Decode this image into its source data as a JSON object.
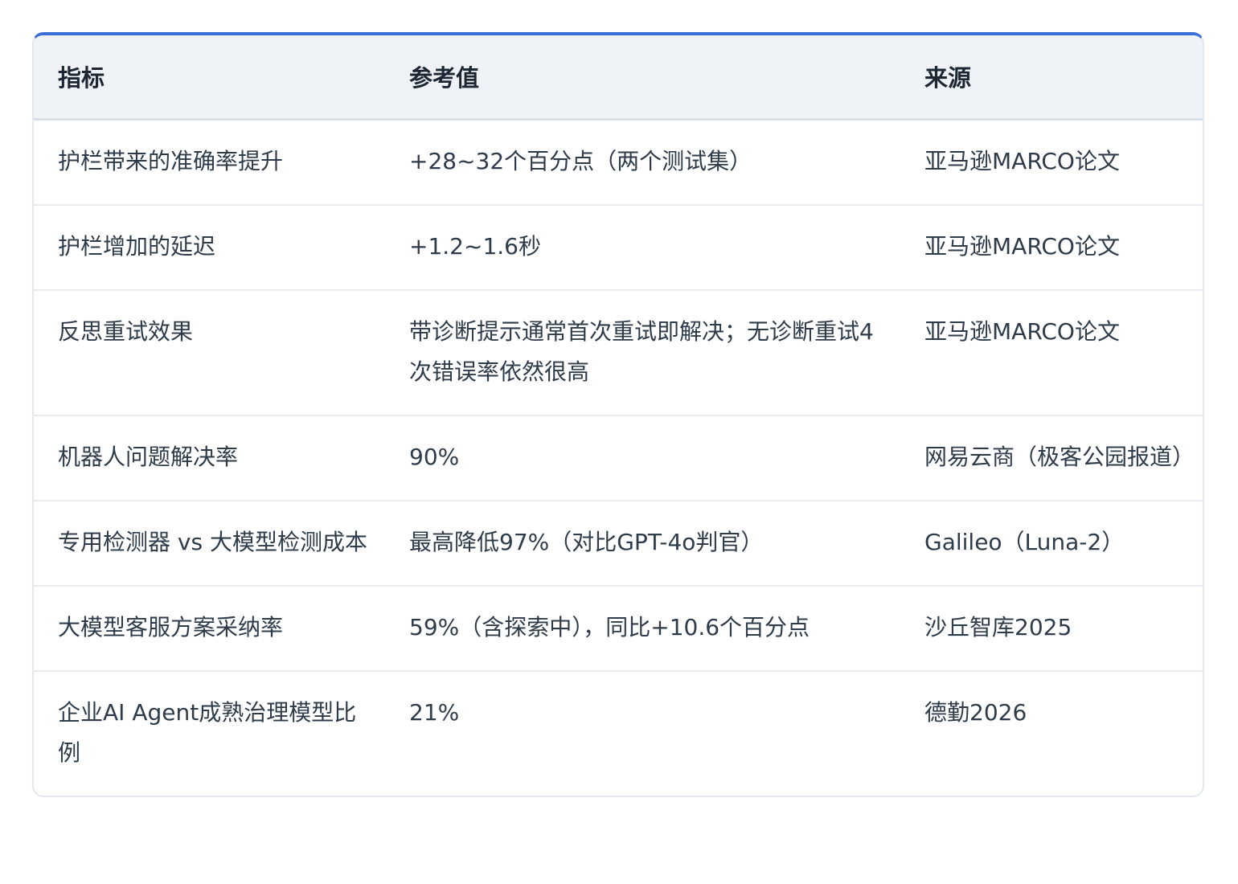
{
  "table": {
    "headers": [
      "指标",
      "参考值",
      "来源"
    ],
    "rows": [
      [
        "护栏带来的准确率提升",
        "+28~32个百分点（两个测试集）",
        "亚马逊MARCO论文"
      ],
      [
        "护栏增加的延迟",
        "+1.2~1.6秒",
        "亚马逊MARCO论文"
      ],
      [
        "反思重试效果",
        "带诊断提示通常首次重试即解决；无诊断重试4次错误率依然很高",
        "亚马逊MARCO论文"
      ],
      [
        "机器人问题解决率",
        "90%",
        "网易云商（极客公园报道）"
      ],
      [
        "专用检测器 vs 大模型检测成本",
        "最高降低97%（对比GPT-4o判官）",
        "Galileo（Luna-2）"
      ],
      [
        "大模型客服方案采纳率",
        "59%（含探索中），同比+10.6个百分点",
        "沙丘智库2025"
      ],
      [
        "企业AI Agent成熟治理模型比例",
        "21%",
        "德勤2026"
      ]
    ]
  },
  "colors": {
    "accent": "#3a6fd8",
    "header_bg": "#eff3f7",
    "border": "#e7ebf0",
    "text": "#2e3b4a"
  }
}
